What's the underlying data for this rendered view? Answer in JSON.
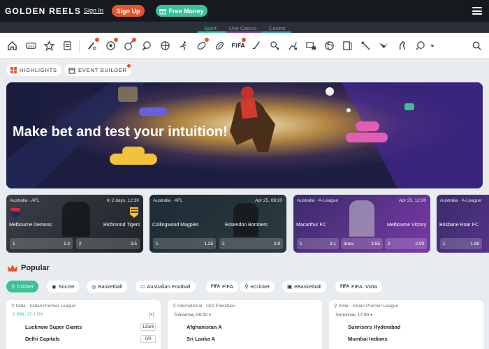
{
  "header": {
    "logo": "GOLDEN REELS",
    "signin": "Sign In",
    "signup": "Sign Up",
    "free_money": "Free Money"
  },
  "subnav": {
    "tabs": [
      {
        "label": "Sport",
        "active": true
      },
      {
        "label": "Live Casino",
        "active": false
      },
      {
        "label": "Casino",
        "active": false
      }
    ]
  },
  "iconbar": {
    "items": [
      "home-icon",
      "live-icon",
      "star-icon",
      "betslip-icon",
      "cricket-icon",
      "soccer-icon",
      "basketball-cricket-icon",
      "chat-icon",
      "basketball-icon",
      "runner-icon",
      "australian-football-icon",
      "rugby-icon",
      "hockey-icon",
      "tennis-icon",
      "horse-racing-icon",
      "fifa-icon",
      "volleyball-icon",
      "esports-icon",
      "stick-icon",
      "mma-icon",
      "horse-icon",
      "badminton-icon",
      "search-icon"
    ],
    "fifa_label": "FIFA"
  },
  "filters": {
    "highlights": "HIGHLIGHTS",
    "event_builder": "EVENT BUILDER"
  },
  "banner": {
    "title": "Make bet and test your intuition!"
  },
  "cards": [
    {
      "league": "Australia · AFL",
      "date": "In 2 days, 12:30",
      "home": "Melbourne Demons",
      "away": "Richmond Tigers",
      "odds": [
        {
          "k": "1",
          "v": "1.3"
        },
        {
          "k": "2",
          "v": "3.5"
        }
      ]
    },
    {
      "league": "Australia · AFL",
      "date": "Apr 25, 08:20",
      "home": "Collingwood Magpies",
      "away": "Essendon Bombers",
      "odds": [
        {
          "k": "1",
          "v": "1.25"
        },
        {
          "k": "2",
          "v": "3.9"
        }
      ]
    },
    {
      "league": "Australia · A-League",
      "date": "Apr 25, 12:30",
      "home": "Macarthur FC",
      "away": "Melbourne Victory",
      "odds": [
        {
          "k": "1",
          "v": "3.1"
        },
        {
          "k": "draw",
          "v": "3.95"
        },
        {
          "k": "2",
          "v": "2.09"
        }
      ]
    },
    {
      "league": "Australia · A-League",
      "date": "",
      "home": "Brisbane Roar FC",
      "away": "",
      "odds": [
        {
          "k": "1",
          "v": "1.88"
        }
      ]
    }
  ],
  "popular": {
    "title": "Popular",
    "tabs": [
      {
        "label": "Cricket",
        "icon": "cricket-icon",
        "active": true
      },
      {
        "label": "Soccer",
        "icon": "soccer-icon",
        "active": false
      },
      {
        "label": "Basketball",
        "icon": "basketball-icon",
        "active": false
      },
      {
        "label": "Australian Football",
        "icon": "australian-football-icon",
        "active": false
      },
      {
        "label": "FIFA",
        "icon": "fifa-icon",
        "active": false
      },
      {
        "label": "eCricket",
        "icon": "ecricket-icon",
        "active": false
      },
      {
        "label": "eBasketball",
        "icon": "ebasketball-icon",
        "active": false
      },
      {
        "label": "FIFA: Volta",
        "icon": "fifa-volta-icon",
        "active": false
      }
    ]
  },
  "matches": [
    {
      "league": "India · Indian Premier League",
      "status": "1 INN, 17.3 OV",
      "status_live": true,
      "teams": [
        {
          "name": "Lucknow Super Giants",
          "score": "133/4"
        },
        {
          "name": "Delhi Capitals",
          "score": "0/0"
        }
      ]
    },
    {
      "league": "International · ODI Friendlies",
      "status": "Tomorrow, 09:00",
      "status_live": false,
      "teams": [
        {
          "name": "Afghanistan A",
          "score": ""
        },
        {
          "name": "Sri Lanka A",
          "score": ""
        }
      ]
    },
    {
      "league": "India · Indian Premier League",
      "status": "Tomorrow, 17:00",
      "status_live": false,
      "teams": [
        {
          "name": "Sunrisers Hyderabad",
          "score": ""
        },
        {
          "name": "Mumbai Indians",
          "score": ""
        }
      ]
    }
  ],
  "colors": {
    "accent_green": "#3ac195",
    "accent_orange": "#e9532b",
    "live_red": "#e9532b"
  }
}
